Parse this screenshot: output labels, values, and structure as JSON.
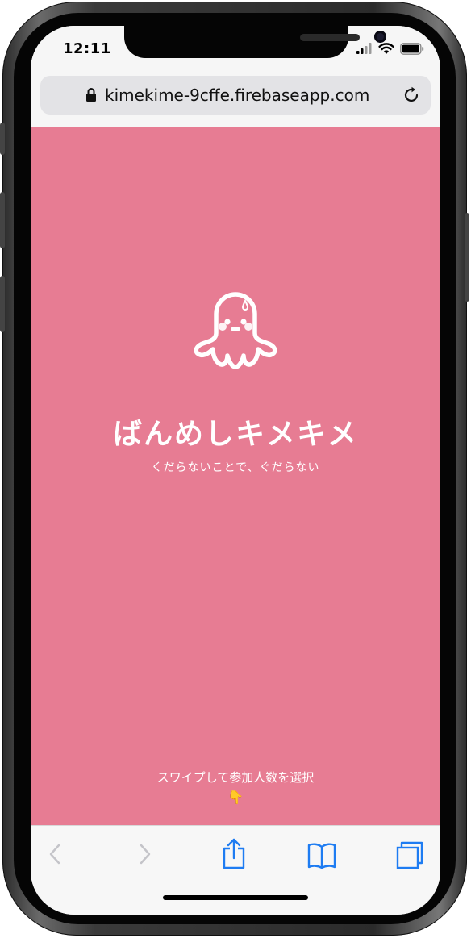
{
  "status_bar": {
    "time": "12:11"
  },
  "browser": {
    "url": "kimekime-9cffe.firebaseapp.com",
    "icons": {
      "lock": "lock-icon",
      "reload": "reload-icon"
    }
  },
  "page": {
    "logo": "ghost-icon",
    "title": "ばんめしキメキメ",
    "tagline": "くだらないことで、ぐだらない",
    "hint": "スワイプして参加人数を選択",
    "hint_emoji": "👇",
    "background_color": "#e77c93"
  },
  "toolbar": {
    "icons": [
      "back-icon",
      "forward-icon",
      "share-icon",
      "bookmarks-icon",
      "tabs-icon"
    ],
    "accent_color": "#1e7cf2",
    "disabled_color": "#c4c4c9"
  }
}
